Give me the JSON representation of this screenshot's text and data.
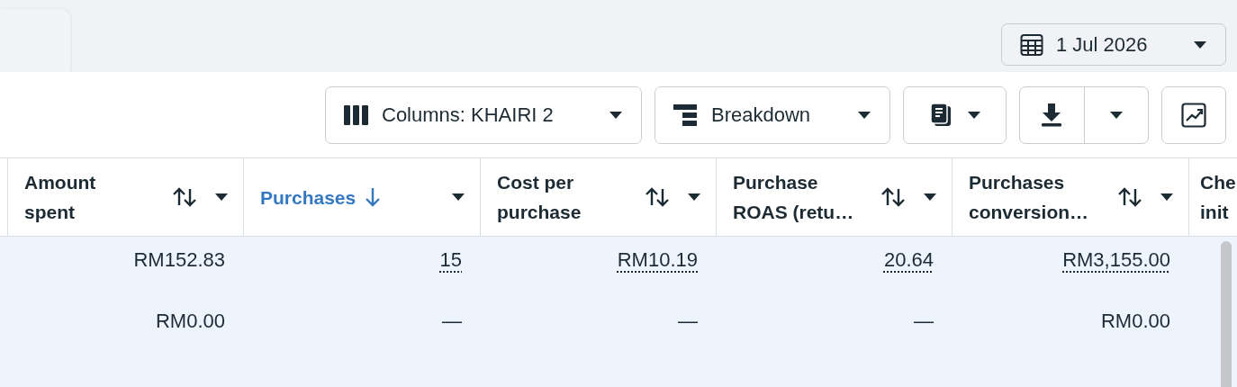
{
  "date_picker": {
    "label": "1 Jul 2026"
  },
  "toolbar": [
    {
      "kind": "columns",
      "label": "Columns: KHAIRI 2"
    },
    {
      "kind": "breakdown",
      "label": "Breakdown"
    },
    {
      "kind": "reports"
    },
    {
      "kind": "download"
    },
    {
      "kind": "chart"
    }
  ],
  "table": {
    "columns": [
      {
        "kind": "full",
        "label": "Amount\nspent",
        "sorted": false
      },
      {
        "kind": "full",
        "label": "Purchases",
        "sorted": true
      },
      {
        "kind": "full",
        "label": "Cost per\npurchase",
        "sorted": false
      },
      {
        "kind": "full",
        "label": "Purchase\nROAS (retu…",
        "sorted": false
      },
      {
        "kind": "full",
        "label": "Purchases\nconversion…",
        "sorted": false
      },
      {
        "kind": "partial",
        "label": "Che\ninit"
      }
    ],
    "rows": [
      [
        {
          "value": "RM152.83",
          "linked": false
        },
        {
          "value": "15",
          "linked": true
        },
        {
          "value": "RM10.19",
          "linked": true
        },
        {
          "value": "20.64",
          "linked": true
        },
        {
          "value": "RM3,155.00",
          "linked": true
        }
      ],
      [
        {
          "value": "RM0.00",
          "linked": false
        },
        {
          "value": "—",
          "linked": false
        },
        {
          "value": "—",
          "linked": false
        },
        {
          "value": "—",
          "linked": false
        },
        {
          "value": "RM0.00",
          "linked": false
        }
      ]
    ]
  }
}
